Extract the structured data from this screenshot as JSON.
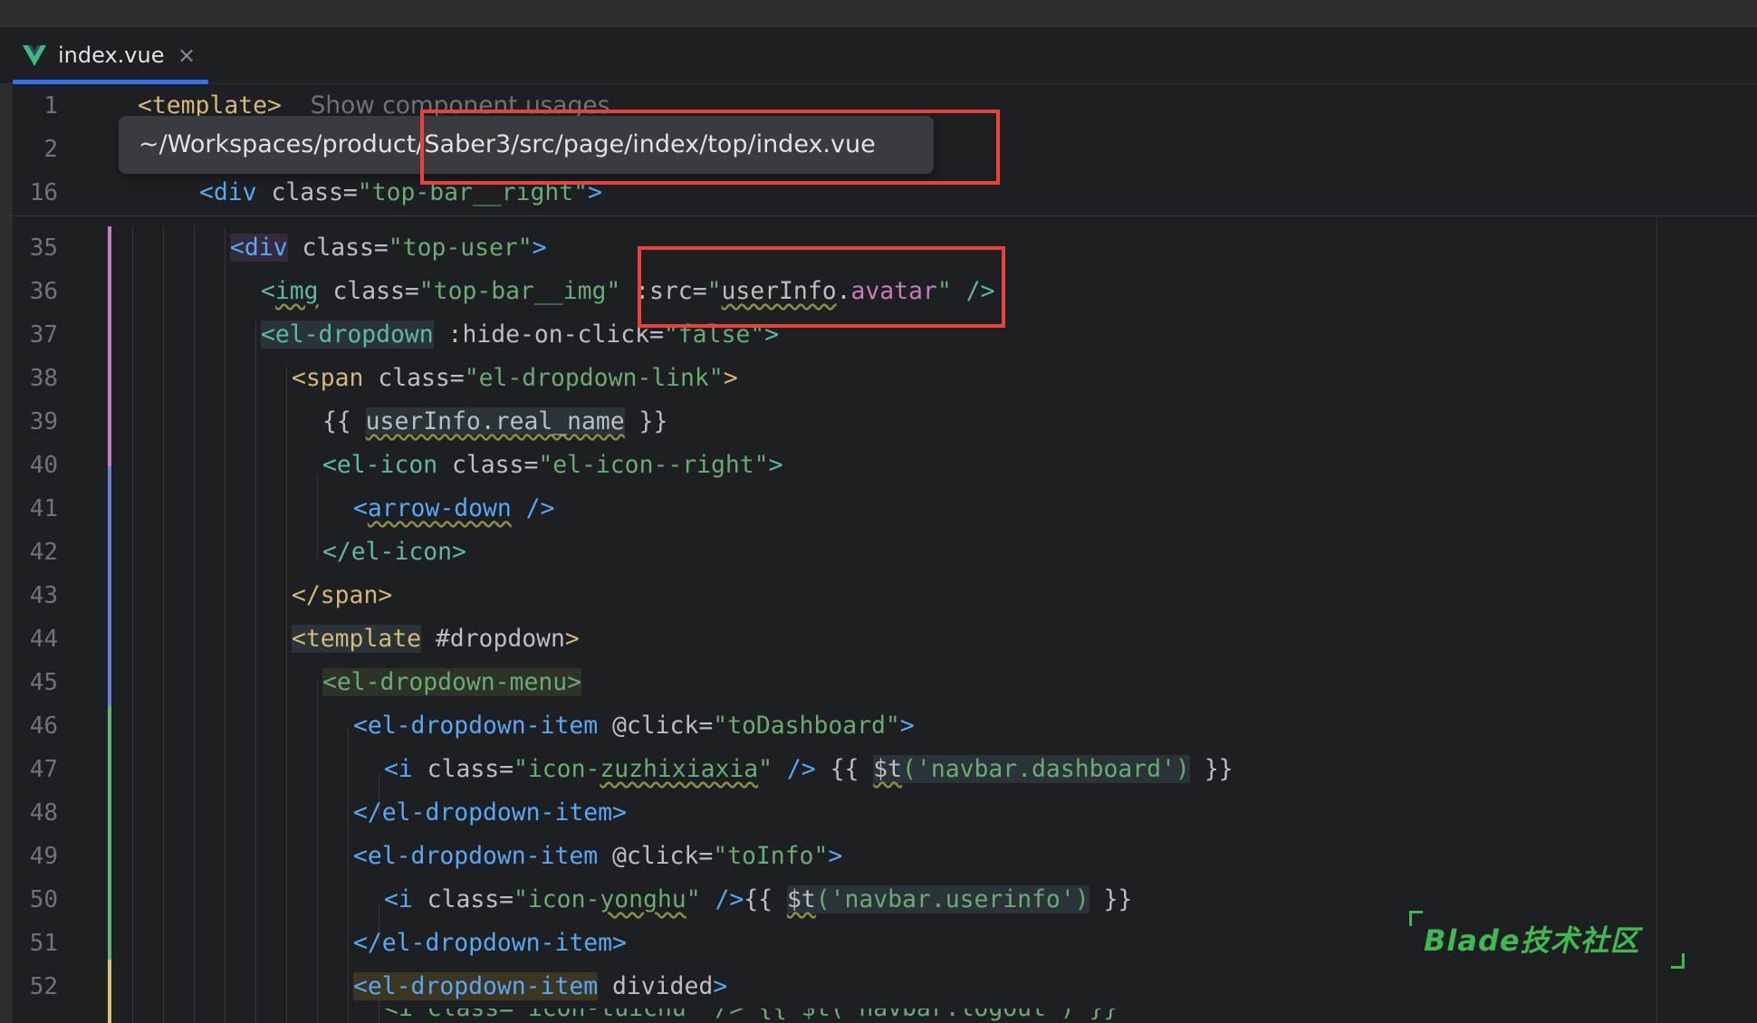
{
  "tab": {
    "title": "index.vue",
    "close": "×"
  },
  "tooltip": {
    "path": "~/Workspaces/product/Saber3/src/page/index/top/index.vue"
  },
  "hint": {
    "usages": "Show component usages"
  },
  "lines": {
    "l1": "1",
    "l2": "2",
    "l16": "16",
    "l35": "35",
    "l36": "36",
    "l37": "37",
    "l38": "38",
    "l39": "39",
    "l40": "40",
    "l41": "41",
    "l42": "42",
    "l43": "43",
    "l44": "44",
    "l45": "45",
    "l46": "46",
    "l47": "47",
    "l48": "48",
    "l49": "49",
    "l50": "50",
    "l51": "51",
    "l52": "52"
  },
  "code": {
    "template_open": "<template>",
    "div_open": "<div",
    "class_attr": " class=",
    "top_bar_right": "\"top-bar__right\"",
    "close_gt": ">",
    "top_user": "\"top-user\"",
    "img_open": "<",
    "img": "img",
    "top_bar_img": "\"top-bar__img\"",
    "src_attr": " :src=",
    "q": "\"",
    "userInfo": "userInfo",
    "dot": ".",
    "avatar": "avatar",
    "self_close": " />",
    "el_dropdown": "<el-dropdown",
    "hide_on_click": " :hide-on-click=",
    "false_val": "\"false\"",
    "span_open": "<span",
    "el_dropdown_link": "\"el-dropdown-link\"",
    "mustache_open": "{{ ",
    "real_name_expr": "userInfo.real_name",
    "mustache_close": " }}",
    "el_icon_open": "<el-icon",
    "el_icon_right": "\"el-icon--right\"",
    "arrow_open": "<",
    "arrow_down": "arrow-down",
    "el_icon_close": "</el-icon>",
    "span_close": "</span>",
    "template2_open": "<template",
    "dropdown_slot": " #dropdown",
    "el_dropdown_menu": "<el-dropdown-menu>",
    "el_dropdown_item": "<el-dropdown-item",
    "click_attr": " @click=",
    "to_dashboard": "\"toDashboard\"",
    "i_open": "<i",
    "icon_zuzhi_a": "\"icon-",
    "icon_zuzhi_b": "zuzhixiaxia",
    "icon_zuzhi_c": "\"",
    "mustache_open2": " {{ ",
    "dollar_t": "$t",
    "dashboard_call": "('navbar.dashboard')",
    "el_dropdown_item_close": "</el-dropdown-item>",
    "to_info": "\"toInfo\"",
    "icon_yong_b": "yonghu",
    "self_close_nospace": " />",
    "mustache_open3": "{{ ",
    "userinfo_call": "('navbar.userinfo')",
    "divided": " divided",
    "cut_line": "<i class=\"icon-tuichu\" /> {{ $t('navbar.logOut') }}"
  },
  "watermark": {
    "text": "Blade技术社区"
  },
  "colors": {
    "accent": "#3574f0",
    "highlight_box": "#e8423c",
    "watermark": "#3fb950"
  }
}
